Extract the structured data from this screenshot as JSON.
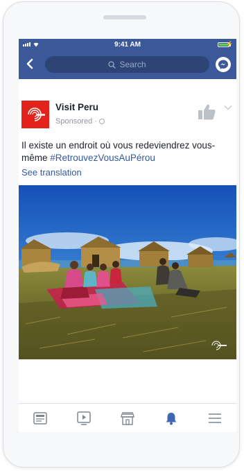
{
  "status_bar": {
    "time": "9:41 AM"
  },
  "header": {
    "search_placeholder": "Search",
    "back_icon": "chevron-left-icon",
    "messenger_icon": "messenger-icon",
    "color": "#3b5998"
  },
  "post": {
    "page_name": "Visit Peru",
    "sponsored_label": "Sponsored",
    "separator": "·",
    "text": "Il existe un endroit où vous redeviendrez vous-même",
    "hashtag": "#RetrouvezVousAuPérou",
    "see_translation": "See translation",
    "like_icon": "thumbs-up-icon",
    "menu_icon": "chevron-down-icon",
    "image_subject": "people seated on reed mats beside reed huts on a lake island"
  },
  "tab_bar": {
    "items": [
      {
        "icon": "news-feed-icon"
      },
      {
        "icon": "video-icon"
      },
      {
        "icon": "marketplace-icon"
      },
      {
        "icon": "notifications-bell-icon",
        "active": true
      },
      {
        "icon": "menu-icon"
      }
    ],
    "active_color": "#4267b2",
    "inactive_color": "#7f8590"
  }
}
